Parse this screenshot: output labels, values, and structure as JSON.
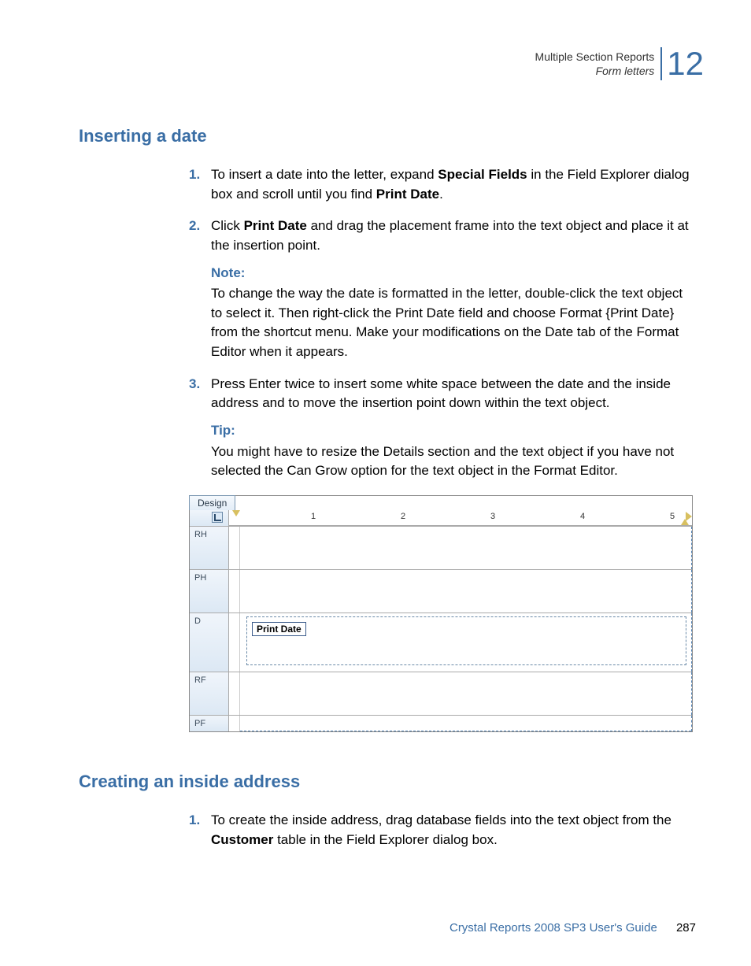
{
  "header": {
    "breadcrumb": "Multiple Section Reports",
    "subcrumb": "Form letters",
    "chapter_number": "12"
  },
  "section1": {
    "heading": "Inserting a date",
    "steps": {
      "s1_num": "1.",
      "s1_pre": "To insert a date into the letter, expand ",
      "s1_bold1": "Special Fields",
      "s1_mid": " in the Field Explorer dialog box and scroll until you find ",
      "s1_bold2": "Print Date",
      "s1_post": ".",
      "s2_num": "2.",
      "s2_pre": "Click ",
      "s2_bold": "Print Date",
      "s2_post": " and drag the placement frame into the text object and place it at the insertion point.",
      "note_label": "Note:",
      "note_body": "To change the way the date is formatted in the letter, double-click the text object to select it. Then right-click the Print Date field and choose Format {Print Date} from the shortcut menu. Make your modifications on the Date tab of the Format Editor when it appears.",
      "s3_num": "3.",
      "s3_body": "Press Enter twice to insert some white space between the date and the inside address and to move the insertion point down within the text object.",
      "tip_label": "Tip:",
      "tip_body": "You might have to resize the Details section and the text object if you have not selected the Can Grow option for the text object in the Format Editor."
    }
  },
  "figure": {
    "tab": "Design",
    "sections": {
      "rh": "RH",
      "ph": "PH",
      "d": "D",
      "rf": "RF",
      "pf": "PF"
    },
    "ruler": {
      "n1": "1",
      "n2": "2",
      "n3": "3",
      "n4": "4",
      "n5": "5"
    },
    "print_date": "Print Date"
  },
  "section2": {
    "heading": "Creating an inside address",
    "s1_num": "1.",
    "s1_pre": "To create the inside address, drag database fields into the text object from the ",
    "s1_bold": "Customer",
    "s1_post": " table in the Field Explorer dialog box."
  },
  "footer": {
    "guide": "Crystal Reports 2008 SP3 User's Guide",
    "page": "287"
  }
}
